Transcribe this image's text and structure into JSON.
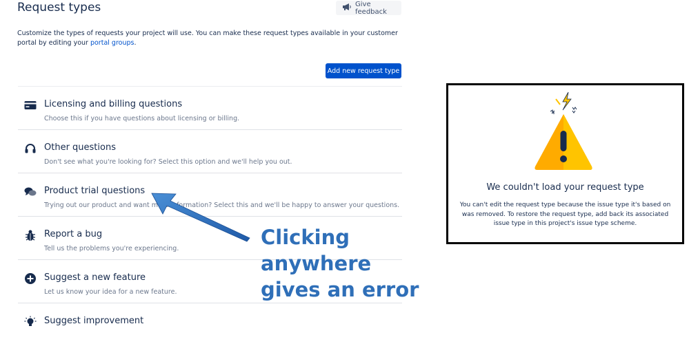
{
  "header": {
    "title": "Request types",
    "feedback_label": "Give feedback"
  },
  "intro": {
    "text_before_link": "Customize the types of requests your project will use. You can make these request types available in your customer portal by editing your ",
    "link_text": "portal groups",
    "text_after_link": "."
  },
  "actions": {
    "add_label": "Add new request type"
  },
  "request_types": [
    {
      "icon": "credit-card-icon",
      "title": "Licensing and billing questions",
      "description": "Choose this if you have questions about licensing or billing."
    },
    {
      "icon": "headset-icon",
      "title": "Other questions",
      "description": "Don't see what you're looking for? Select this option and we'll help you out."
    },
    {
      "icon": "chat-bubbles-icon",
      "title": "Product trial questions",
      "description": "Trying out our product and want more information? Select this and we'll be happy to answer your questions."
    },
    {
      "icon": "bug-icon",
      "title": "Report a bug",
      "description": "Tell us the problems you're experiencing."
    },
    {
      "icon": "plus-circle-icon",
      "title": "Suggest a new feature",
      "description": "Let us know your idea for a new feature."
    },
    {
      "icon": "lightbulb-icon",
      "title": "Suggest improvement",
      "description": ""
    }
  ],
  "error": {
    "title": "We couldn't load your request type",
    "body": "You can't edit the request type because the issue type it's based on was removed. To restore the request type, add back its associated issue type in this project's issue type scheme."
  },
  "annotation": {
    "text": "Clicking\nanywhere\ngives an error",
    "color": "#2f6fb8"
  },
  "colors": {
    "primary": "#0052cc",
    "text": "#172b4d",
    "subtle": "#6b778c",
    "warning": "#ffab00"
  }
}
